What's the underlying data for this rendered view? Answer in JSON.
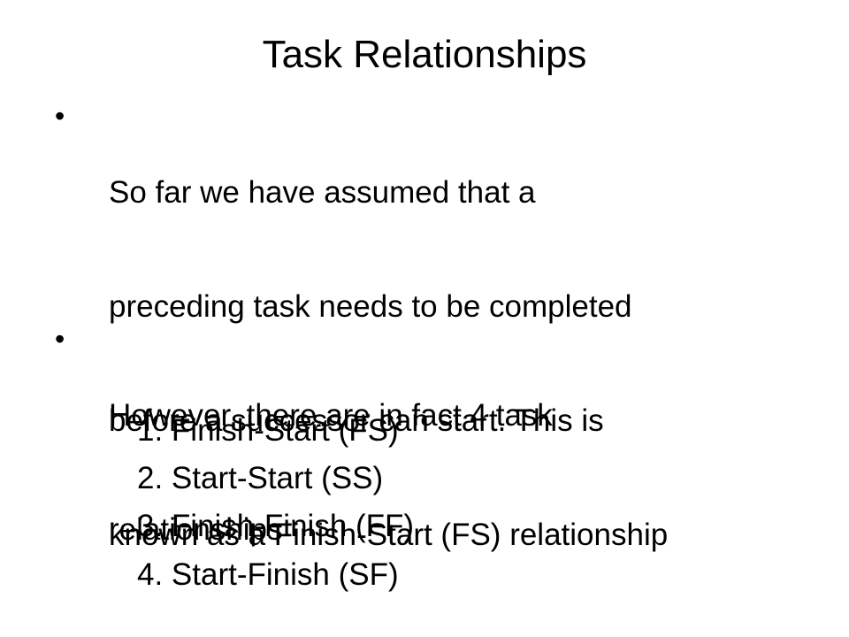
{
  "slide": {
    "title": "Task Relationships",
    "bullets": [
      {
        "symbol": "•",
        "lines": [
          "So far we have assumed that a",
          "preceding task needs to be completed",
          "before a successor can start.  This is",
          "known as a Finish-Start (FS) relationship"
        ]
      },
      {
        "symbol": "•",
        "lines": [
          "However, there are in fact 4 task",
          "relationships"
        ]
      }
    ],
    "relationships": [
      "1. Finish-Start (FS)",
      "2. Start-Start (SS)",
      "3. Finish-Finish (FF)",
      "4. Start-Finish (SF)"
    ]
  }
}
